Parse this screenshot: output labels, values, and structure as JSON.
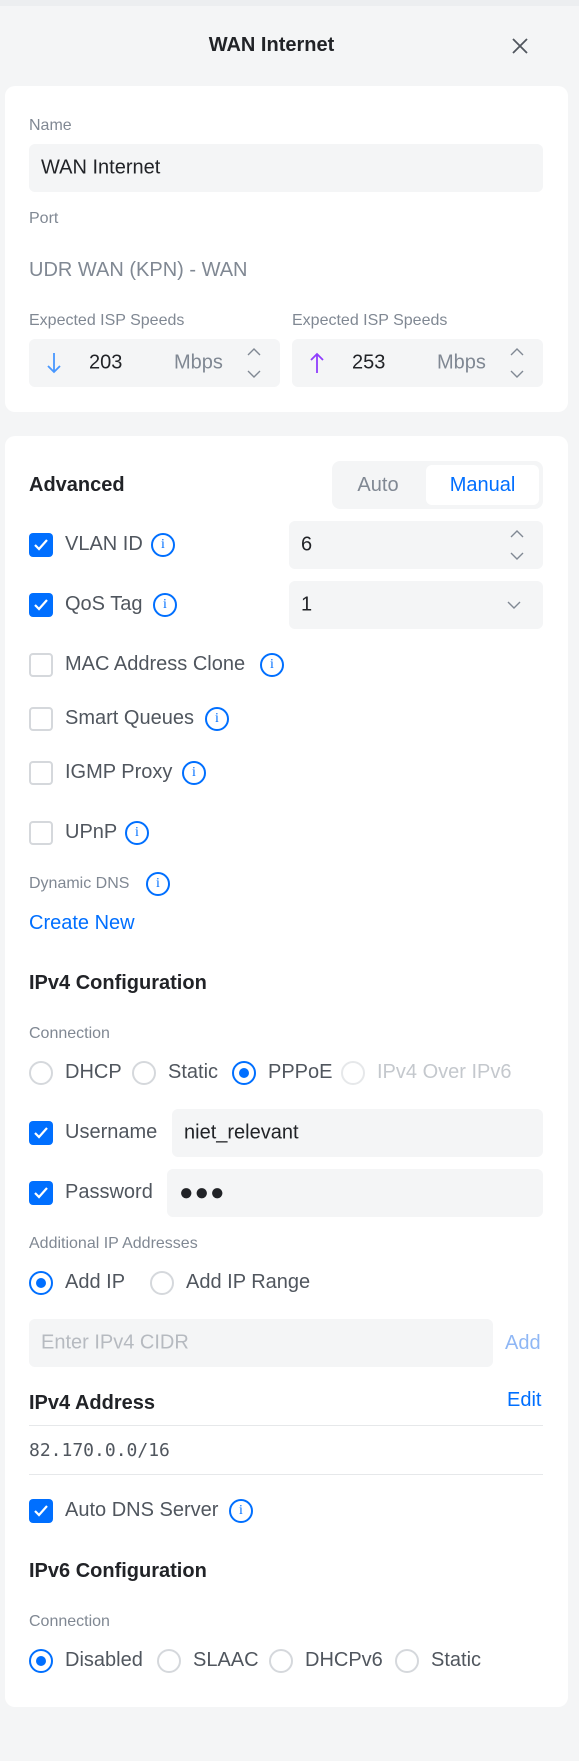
{
  "header": {
    "title": "WAN Internet"
  },
  "general": {
    "name_label": "Name",
    "name_value": "WAN Internet",
    "port_label": "Port",
    "port_value": "UDR WAN (KPN) - WAN",
    "download": {
      "label": "Expected ISP Speeds",
      "value": "203",
      "unit": "Mbps"
    },
    "upload": {
      "label": "Expected ISP Speeds",
      "value": "253",
      "unit": "Mbps"
    }
  },
  "advanced": {
    "title": "Advanced",
    "mode_auto": "Auto",
    "mode_manual": "Manual",
    "vlan": {
      "label": "VLAN ID",
      "value": "6"
    },
    "qos": {
      "label": "QoS Tag",
      "value": "1"
    },
    "mac_clone": "MAC Address Clone",
    "smart_queues": "Smart Queues",
    "igmp_proxy": "IGMP Proxy",
    "upnp": "UPnP",
    "ddns_label": "Dynamic DNS",
    "create_new": "Create New"
  },
  "ipv4": {
    "title": "IPv4 Configuration",
    "connection_label": "Connection",
    "options": [
      "DHCP",
      "Static",
      "PPPoE",
      "IPv4 Over IPv6"
    ],
    "username_label": "Username",
    "username_value": "niet_relevant",
    "password_label": "Password",
    "password_value": "●●●",
    "additional_label": "Additional IP Addresses",
    "add_ip": "Add IP",
    "add_ip_range": "Add IP Range",
    "cidr_placeholder": "Enter IPv4 CIDR",
    "add_button": "Add",
    "address_title": "IPv4 Address",
    "edit": "Edit",
    "address_value": "82.170.0.0/16",
    "auto_dns": "Auto DNS Server"
  },
  "ipv6": {
    "title": "IPv6 Configuration",
    "connection_label": "Connection",
    "options": [
      "Disabled",
      "SLAAC",
      "DHCPv6",
      "Static"
    ]
  },
  "colors": {
    "accent": "#006fff",
    "upload_arrow": "#8f3dfd",
    "download_arrow": "#4797ff"
  },
  "icons": [
    "close-icon",
    "down-arrow-icon",
    "up-arrow-icon",
    "info-icon",
    "check-icon",
    "chevron-down-icon",
    "stepper-icon"
  ]
}
